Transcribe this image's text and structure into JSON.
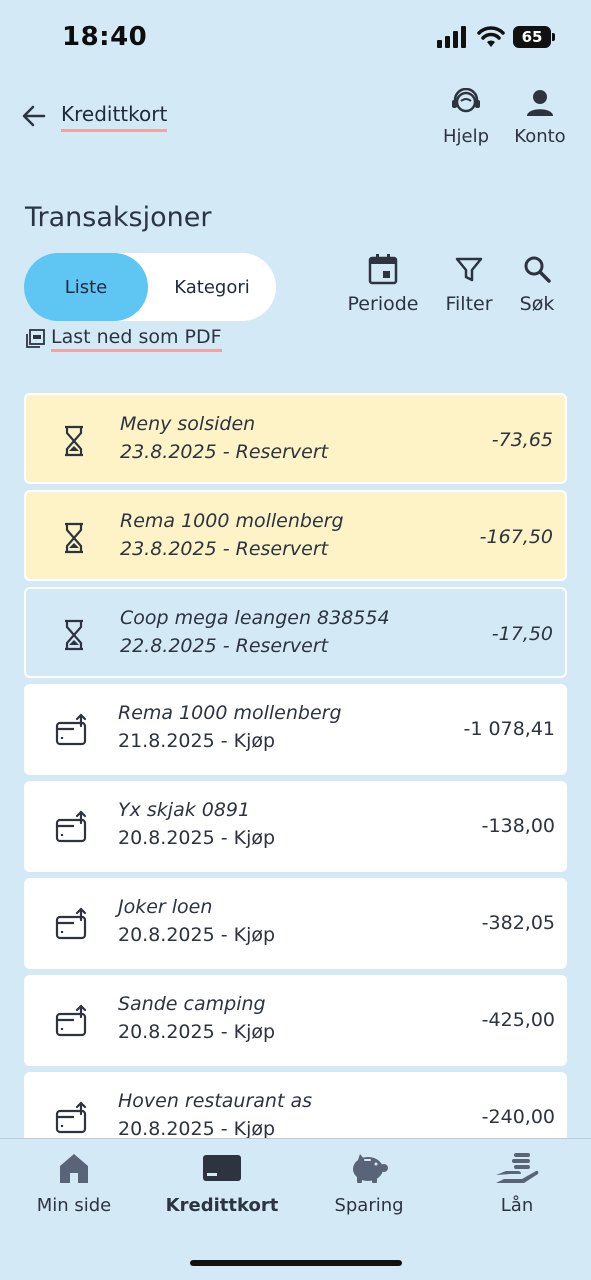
{
  "status": {
    "time": "18:40",
    "battery": "65"
  },
  "header": {
    "title": "Kredittkort",
    "help_label": "Hjelp",
    "account_label": "Konto"
  },
  "section": {
    "title": "Transaksjoner"
  },
  "segment": {
    "list_label": "Liste",
    "category_label": "Kategori"
  },
  "tools": {
    "period_label": "Periode",
    "filter_label": "Filter",
    "search_label": "Søk"
  },
  "pdf": {
    "label": "Last ned som PDF"
  },
  "transactions": [
    {
      "name": "Meny solsiden",
      "meta": "23.8.2025 - Reservert",
      "amount": "-73,65",
      "status": "reserved",
      "icon": "hourglass-icon"
    },
    {
      "name": "Rema 1000 mollenberg",
      "meta": "23.8.2025 - Reservert",
      "amount": "-167,50",
      "status": "reserved",
      "icon": "hourglass-icon"
    },
    {
      "name": "Coop mega leangen 838554",
      "meta": "22.8.2025 - Reservert",
      "amount": "-17,50",
      "status": "reserved",
      "icon": "hourglass-icon"
    },
    {
      "name": "Rema 1000 mollenberg",
      "meta": "21.8.2025 - Kjøp",
      "amount": "-1 078,41",
      "status": "purchase",
      "icon": "card-purchase-icon"
    },
    {
      "name": "Yx skjak 0891",
      "meta": "20.8.2025 - Kjøp",
      "amount": "-138,00",
      "status": "purchase",
      "icon": "card-purchase-icon"
    },
    {
      "name": "Joker loen",
      "meta": "20.8.2025 - Kjøp",
      "amount": "-382,05",
      "status": "purchase",
      "icon": "card-purchase-icon"
    },
    {
      "name": "Sande camping",
      "meta": "20.8.2025 - Kjøp",
      "amount": "-425,00",
      "status": "purchase",
      "icon": "card-purchase-icon"
    },
    {
      "name": "Hoven restaurant as",
      "meta": "20.8.2025 - Kjøp",
      "amount": "-240,00",
      "status": "purchase",
      "icon": "card-purchase-icon"
    }
  ],
  "bottom_nav": [
    {
      "label": "Min side",
      "icon": "home-icon",
      "active": false
    },
    {
      "label": "Kredittkort",
      "icon": "credit-card-icon",
      "active": true
    },
    {
      "label": "Sparing",
      "icon": "piggy-bank-icon",
      "active": false
    },
    {
      "label": "Lån",
      "icon": "loan-hand-icon",
      "active": false
    }
  ],
  "colors": {
    "background": "#d3eaf6",
    "accent": "#5fc5f3",
    "reserved_highlight": "#fdf3c7",
    "link_underline": "#f1a3a3",
    "text": "#2d3440"
  }
}
